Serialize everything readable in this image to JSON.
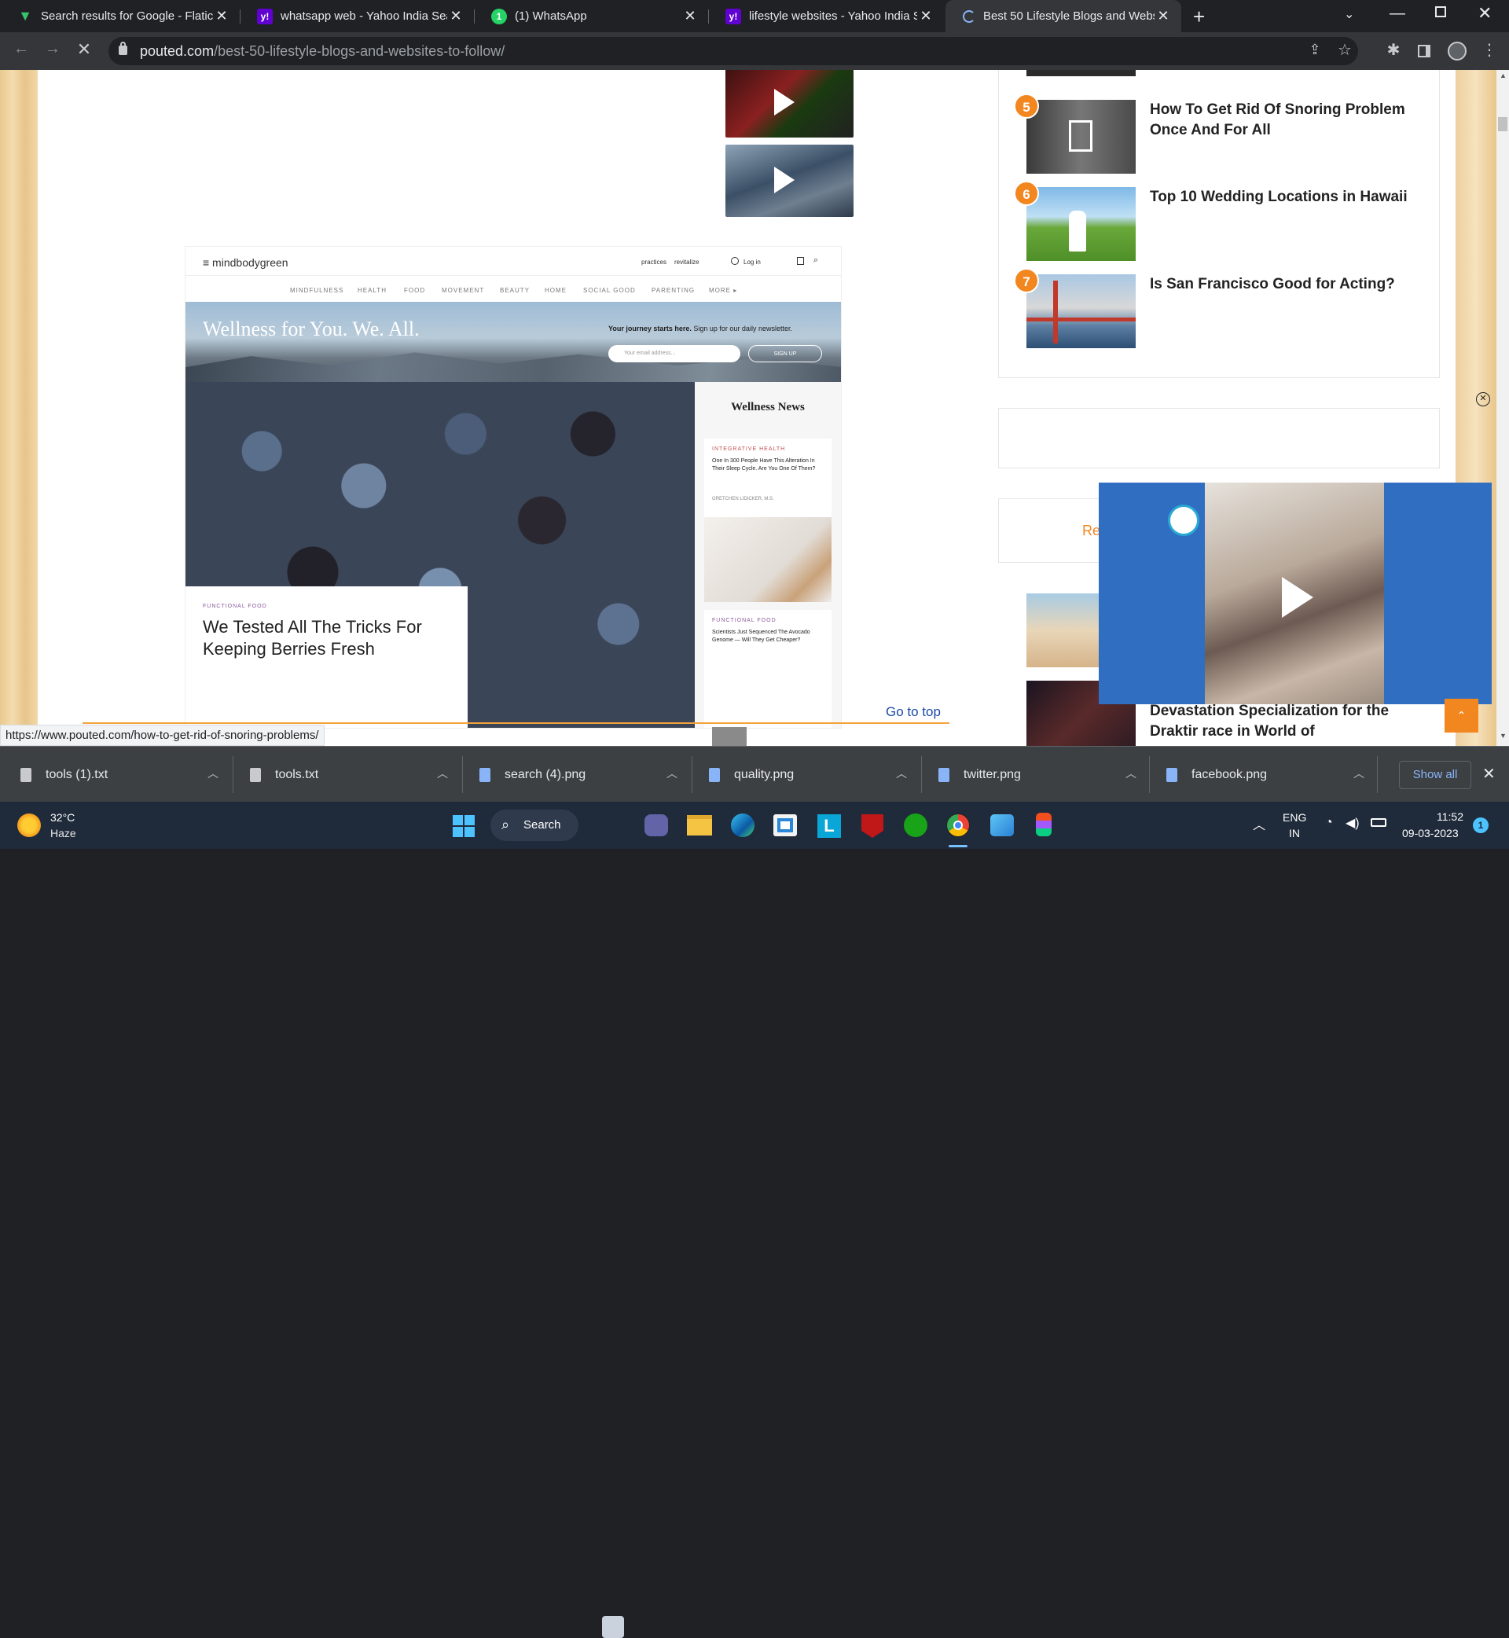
{
  "browser": {
    "tabs": [
      {
        "title": "Search results for Google - Flatic",
        "favicon": "flaticon-icon",
        "color": "#37c46c"
      },
      {
        "title": "whatsapp web - Yahoo India Sear",
        "favicon": "yahoo-icon",
        "color": "#6001d2"
      },
      {
        "title": "(1) WhatsApp",
        "favicon": "whatsapp-icon",
        "color": "#25d366"
      },
      {
        "title": "lifestyle websites - Yahoo India S",
        "favicon": "yahoo-icon",
        "color": "#6001d2"
      },
      {
        "title": "Best 50 Lifestyle Blogs and Webs",
        "favicon": "loading-spinner-icon",
        "color": "#8ab4f8"
      }
    ],
    "url_host": "pouted.com",
    "url_path": "/best-50-lifestyle-blogs-and-websites-to-follow/",
    "status_url": "https://www.pouted.com/how-to-get-rid-of-snoring-problems/"
  },
  "article": {
    "screenshot": {
      "logo": "≡ mindbodygreen",
      "top_links": [
        "practices",
        "revitalize"
      ],
      "login": "Log in",
      "nav": [
        "MINDFULNESS",
        "HEALTH",
        "FOOD",
        "MOVEMENT",
        "BEAUTY",
        "HOME",
        "SOCIAL GOOD",
        "PARENTING",
        "MORE ▸"
      ],
      "hero_title": "Wellness for You. We. All.",
      "newsletter_bold": "Your journey starts here.",
      "newsletter_text": "Sign up for our daily newsletter.",
      "email_placeholder": "Your email address...",
      "signup": "SIGN UP",
      "feature_category": "FUNCTIONAL FOOD",
      "feature_title": "We Tested All The Tricks For Keeping Berries Fresh",
      "news_heading": "Wellness News",
      "news1_category": "INTEGRATIVE HEALTH",
      "news1_title": "One In 300 People Have This Alteration In Their Sleep Cycle. Are You One Of Them?",
      "news1_author": "GRETCHEN LIDICKER, M.S.",
      "news2_category": "FUNCTIONAL FOOD",
      "news2_title": "Scientists Just Sequenced The Avocado Genome — Will They Get Cheaper?"
    },
    "go_to_top": "Go to top"
  },
  "sidebar": {
    "posts": [
      {
        "num": "5",
        "title": "How To Get Rid Of Snoring Problem Once And For All"
      },
      {
        "num": "6",
        "title": "Top 10 Wedding Locations in Hawaii"
      },
      {
        "num": "7",
        "title": "Is San Francisco Good for Acting?"
      }
    ],
    "recent_partial": "Re",
    "post_guide": "Guide to the Awakener class of the Devastation Specialization for the Draktir race in World of"
  },
  "downloads": {
    "items": [
      "tools (1).txt",
      "tools.txt",
      "search (4).png",
      "quality.png",
      "twitter.png",
      "facebook.png"
    ],
    "show_all": "Show all"
  },
  "taskbar": {
    "temp": "32°C",
    "weather": "Haze",
    "search": "Search",
    "lang": "ENG",
    "region": "IN",
    "time": "11:52",
    "date": "09-03-2023",
    "notifications": "1"
  }
}
